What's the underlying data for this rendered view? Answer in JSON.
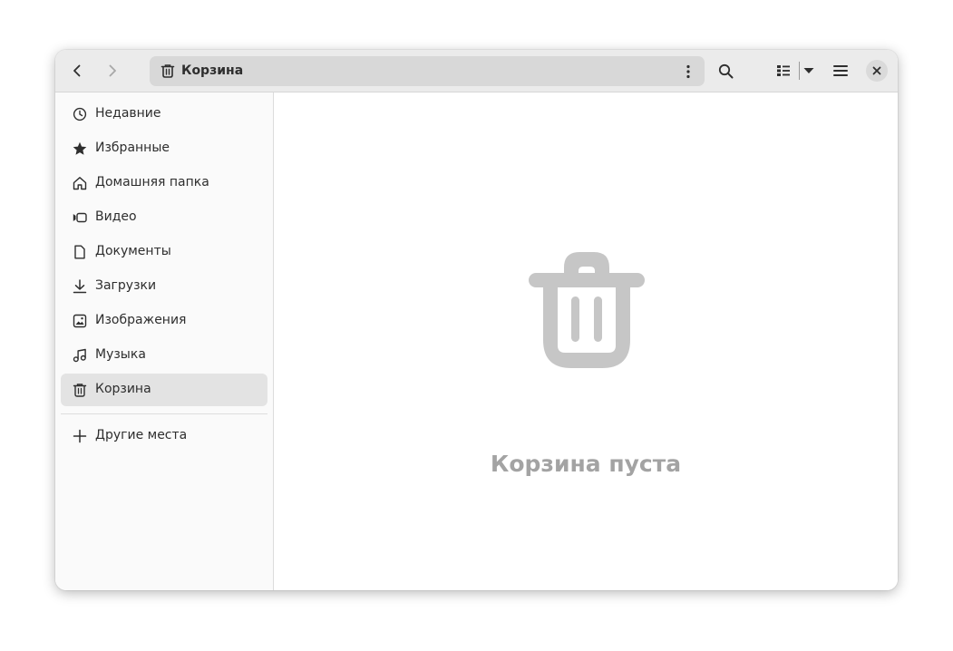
{
  "window": {
    "path_label": "Корзина"
  },
  "toolbar": {
    "icons": [
      "go-back-icon",
      "go-forward-icon",
      "trash-icon",
      "path-menu-icon",
      "search-icon",
      "list-view-icon",
      "view-options-dropdown-icon",
      "main-menu-icon",
      "close-icon"
    ]
  },
  "sidebar": {
    "items": [
      {
        "label": "Недавние",
        "icon": "recent-icon"
      },
      {
        "label": "Избранные",
        "icon": "starred-icon"
      },
      {
        "label": "Домашняя папка",
        "icon": "home-icon"
      },
      {
        "label": "Видео",
        "icon": "video-icon"
      },
      {
        "label": "Документы",
        "icon": "document-icon"
      },
      {
        "label": "Загрузки",
        "icon": "download-icon"
      },
      {
        "label": "Изображения",
        "icon": "image-icon"
      },
      {
        "label": "Музыка",
        "icon": "music-icon"
      },
      {
        "label": "Корзина",
        "icon": "trash-icon",
        "selected": true
      }
    ],
    "other_locations": {
      "label": "Другие места",
      "icon": "plus-icon"
    }
  },
  "content": {
    "empty_label": "Корзина пуста",
    "empty_icon": "trash-icon"
  },
  "colors": {
    "headerbar": "#ebebeb",
    "pathbar": "#d8d8d8",
    "sidebar": "#fafafa",
    "selected_item": "#e3e3e3",
    "empty_state": "#c6c6c6",
    "empty_text": "#a3a3a3"
  }
}
